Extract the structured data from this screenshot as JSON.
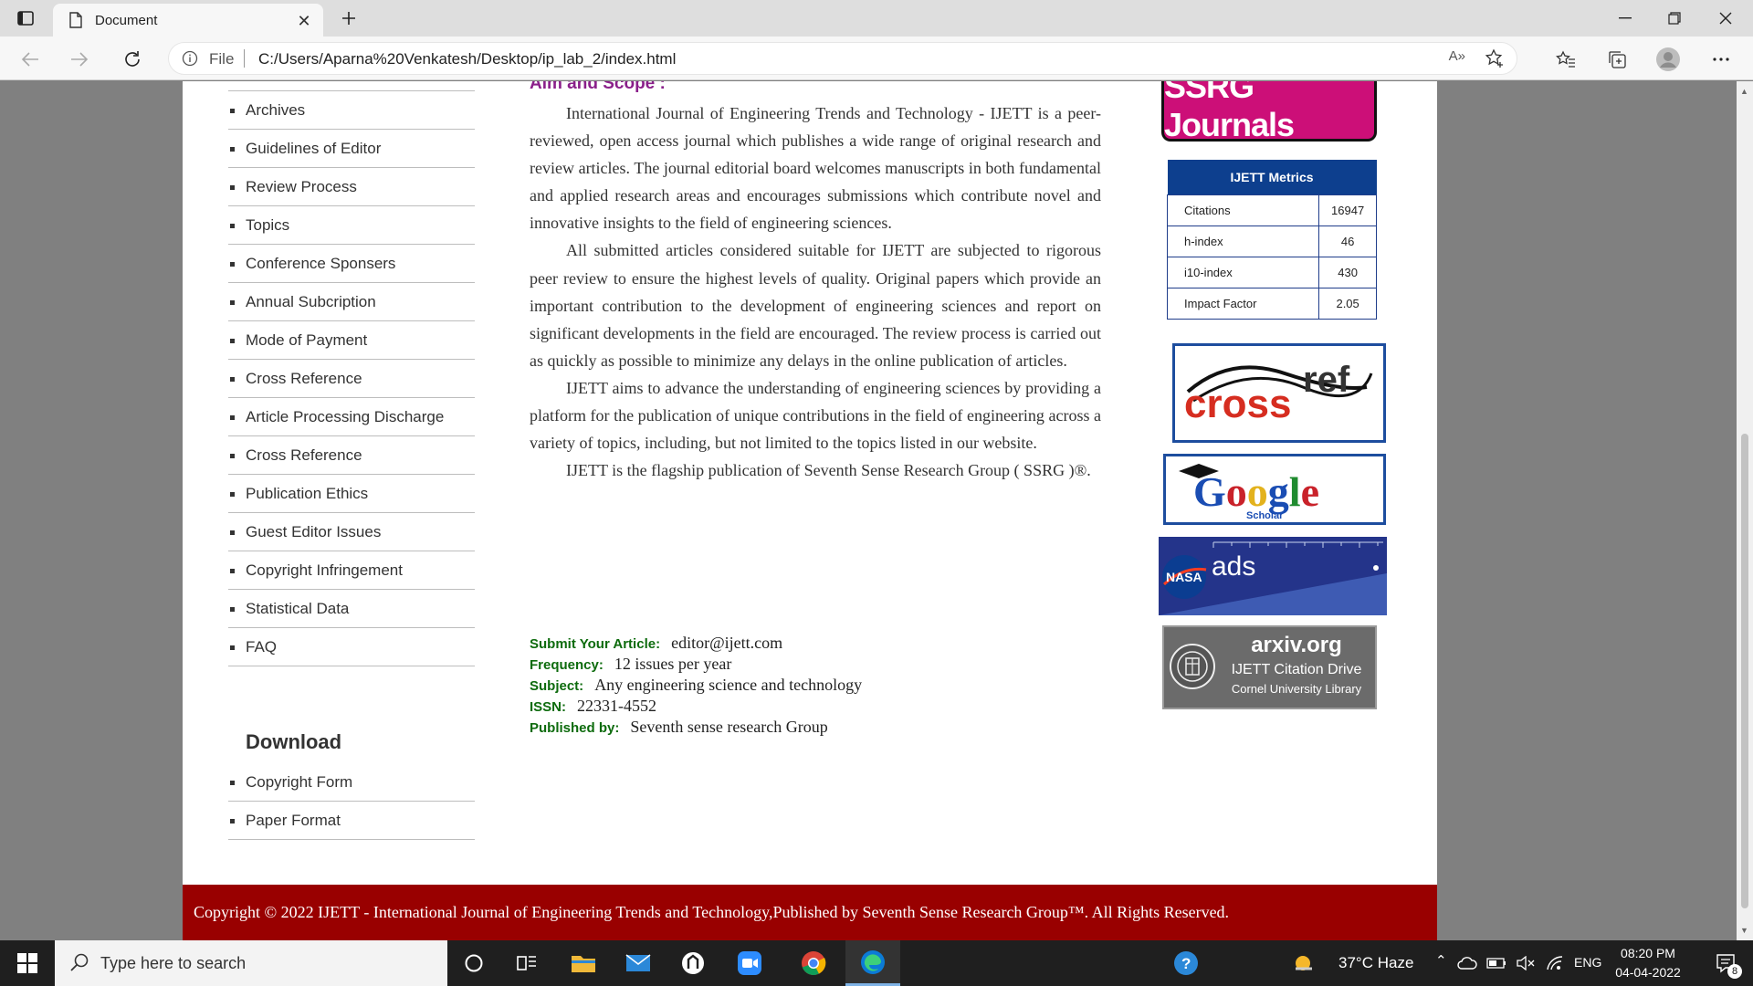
{
  "browser": {
    "tab_title": "Document",
    "address_prefix": "File",
    "url": "C:/Users/Aparna%20Venkatesh/Desktop/ip_lab_2/index.html",
    "read_aloud_label": "A»"
  },
  "sidebar": {
    "items": [
      {
        "label": "Archives"
      },
      {
        "label": "Guidelines of Editor"
      },
      {
        "label": "Review Process"
      },
      {
        "label": "Topics"
      },
      {
        "label": "Conference Sponsers"
      },
      {
        "label": "Annual Subcription"
      },
      {
        "label": "Mode of Payment"
      },
      {
        "label": "Cross Reference"
      },
      {
        "label": "Article Processing Discharge"
      },
      {
        "label": "Cross Reference"
      },
      {
        "label": "Publication Ethics"
      },
      {
        "label": "Guest Editor Issues"
      },
      {
        "label": "Copyright Infringement"
      },
      {
        "label": "Statistical Data"
      },
      {
        "label": "FAQ"
      }
    ],
    "download_heading": "Download",
    "download_items": [
      {
        "label": "Copyright Form"
      },
      {
        "label": "Paper Format"
      }
    ]
  },
  "main": {
    "aim_title": "Aim and Scope :",
    "paragraphs": [
      "International Journal of Engineering Trends and Technology - IJETT is a peer-reviewed, open access journal which publishes a wide range of original research and review articles. The journal editorial board welcomes manuscripts in both fundamental and applied research areas and encourages submissions which contribute novel and innovative insights to the field of engineering sciences.",
      "All submitted articles considered suitable for IJETT are subjected to rigorous peer review to ensure the highest levels of quality. Original papers which provide an important contribution to the development of engineering sciences and report on significant developments in the field are encouraged. The review process is carried out as quickly as possible to minimize any delays in the online publication of articles.",
      "IJETT aims to advance the understanding of engineering sciences by providing a platform for the publication of unique contributions in the field of engineering across a variety of topics, including, but not limited to the topics listed in our website.",
      "IJETT is the flagship publication of Seventh Sense Research Group ( SSRG )®."
    ],
    "details": [
      {
        "label": "Submit Your Article:",
        "value": "editor@ijett.com"
      },
      {
        "label": "Frequency:",
        "value": "12 issues per year"
      },
      {
        "label": "Subject:",
        "value": "Any engineering science and technology"
      },
      {
        "label": "ISSN:",
        "value": "22331-4552"
      },
      {
        "label": "Published by:",
        "value": "Seventh sense research Group"
      }
    ]
  },
  "right": {
    "ssrg_logo_text": "SSRG Journals",
    "metrics_title": "IJETT Metrics",
    "metrics": [
      {
        "label": "Citations",
        "value": "16947"
      },
      {
        "label": "h-index",
        "value": "46"
      },
      {
        "label": "i10-index",
        "value": "430"
      },
      {
        "label": "Impact Factor",
        "value": "2.05"
      }
    ],
    "crossref_text": "crossref",
    "google_text": "Google",
    "google_sub": "Scholar",
    "nasa_text": "NASA",
    "ads_text": "ads",
    "arxiv_title": "arxiv.org",
    "arxiv_line1": "IJETT Citation Drive",
    "arxiv_line2": "Cornel University Library"
  },
  "footer": {
    "text": "Copyright © 2022 IJETT - International Journal of Engineering Trends and Technology,Published by Seventh Sense Research Group™. All Rights Reserved."
  },
  "taskbar": {
    "search_placeholder": "Type here to search",
    "weather": "37°C  Haze",
    "language": "ENG",
    "time": "08:20 PM",
    "date": "04-04-2022",
    "notification_count": "8"
  },
  "colors": {
    "aim_title": "#8a1f8a",
    "detail_label": "#0d6b0d",
    "footer_bg": "#990000",
    "metrics_header": "#0d3f8e",
    "ssrg_bg": "#cc0f78"
  }
}
